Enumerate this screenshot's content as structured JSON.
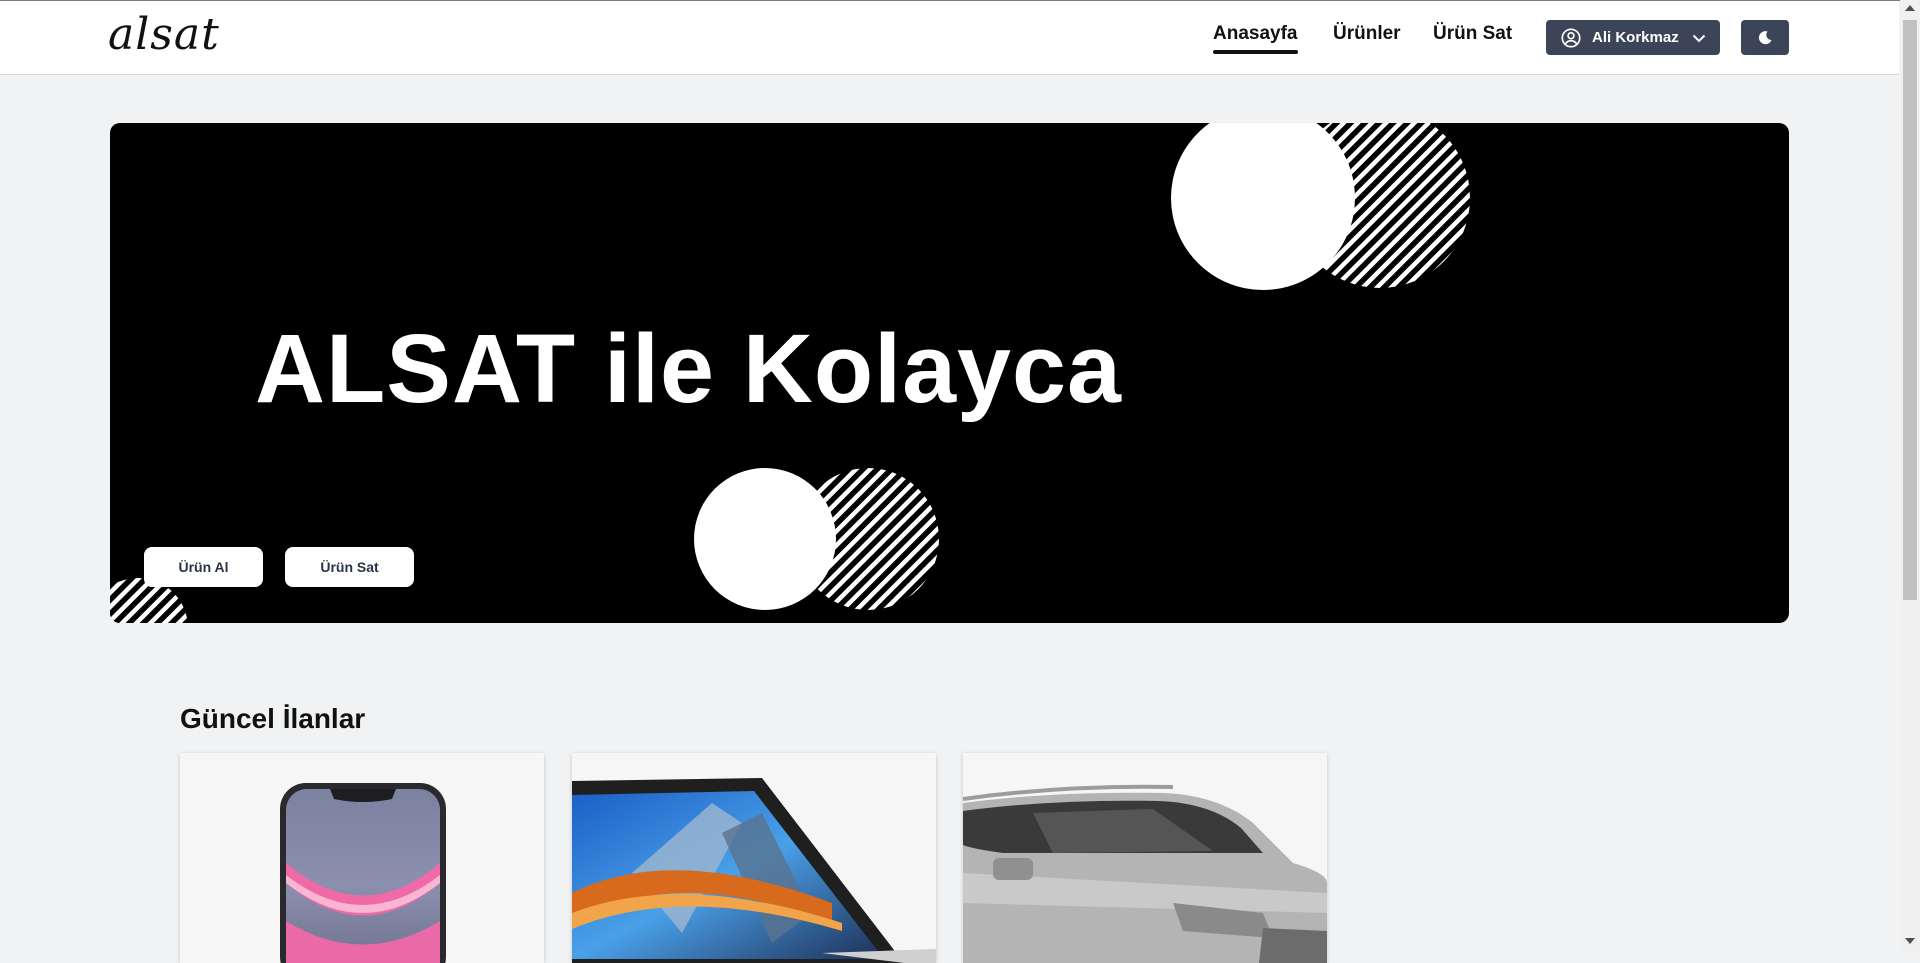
{
  "navbar": {
    "logo": "alsat",
    "links": [
      {
        "label": "Anasayfa",
        "active": true
      },
      {
        "label": "Ürünler",
        "active": false
      },
      {
        "label": "Ürün Sat",
        "active": false
      }
    ],
    "user": {
      "name": "Ali Korkmaz",
      "icon": "user-circle-icon",
      "dropdown_icon": "chevron-down-icon"
    },
    "theme_toggle_icon": "moon-icon"
  },
  "hero": {
    "title": "ALSAT ile Kolayca",
    "buttons": [
      {
        "label": "Ürün Al"
      },
      {
        "label": "Ürün Sat"
      }
    ]
  },
  "listings": {
    "title": "Güncel İlanlar",
    "items": [
      {
        "image": "phone-image"
      },
      {
        "image": "laptop-image"
      },
      {
        "image": "car-image"
      }
    ]
  },
  "colors": {
    "primary_dark": "#3b4557",
    "hero_bg": "#000000",
    "page_bg": "#f1f2f3"
  }
}
